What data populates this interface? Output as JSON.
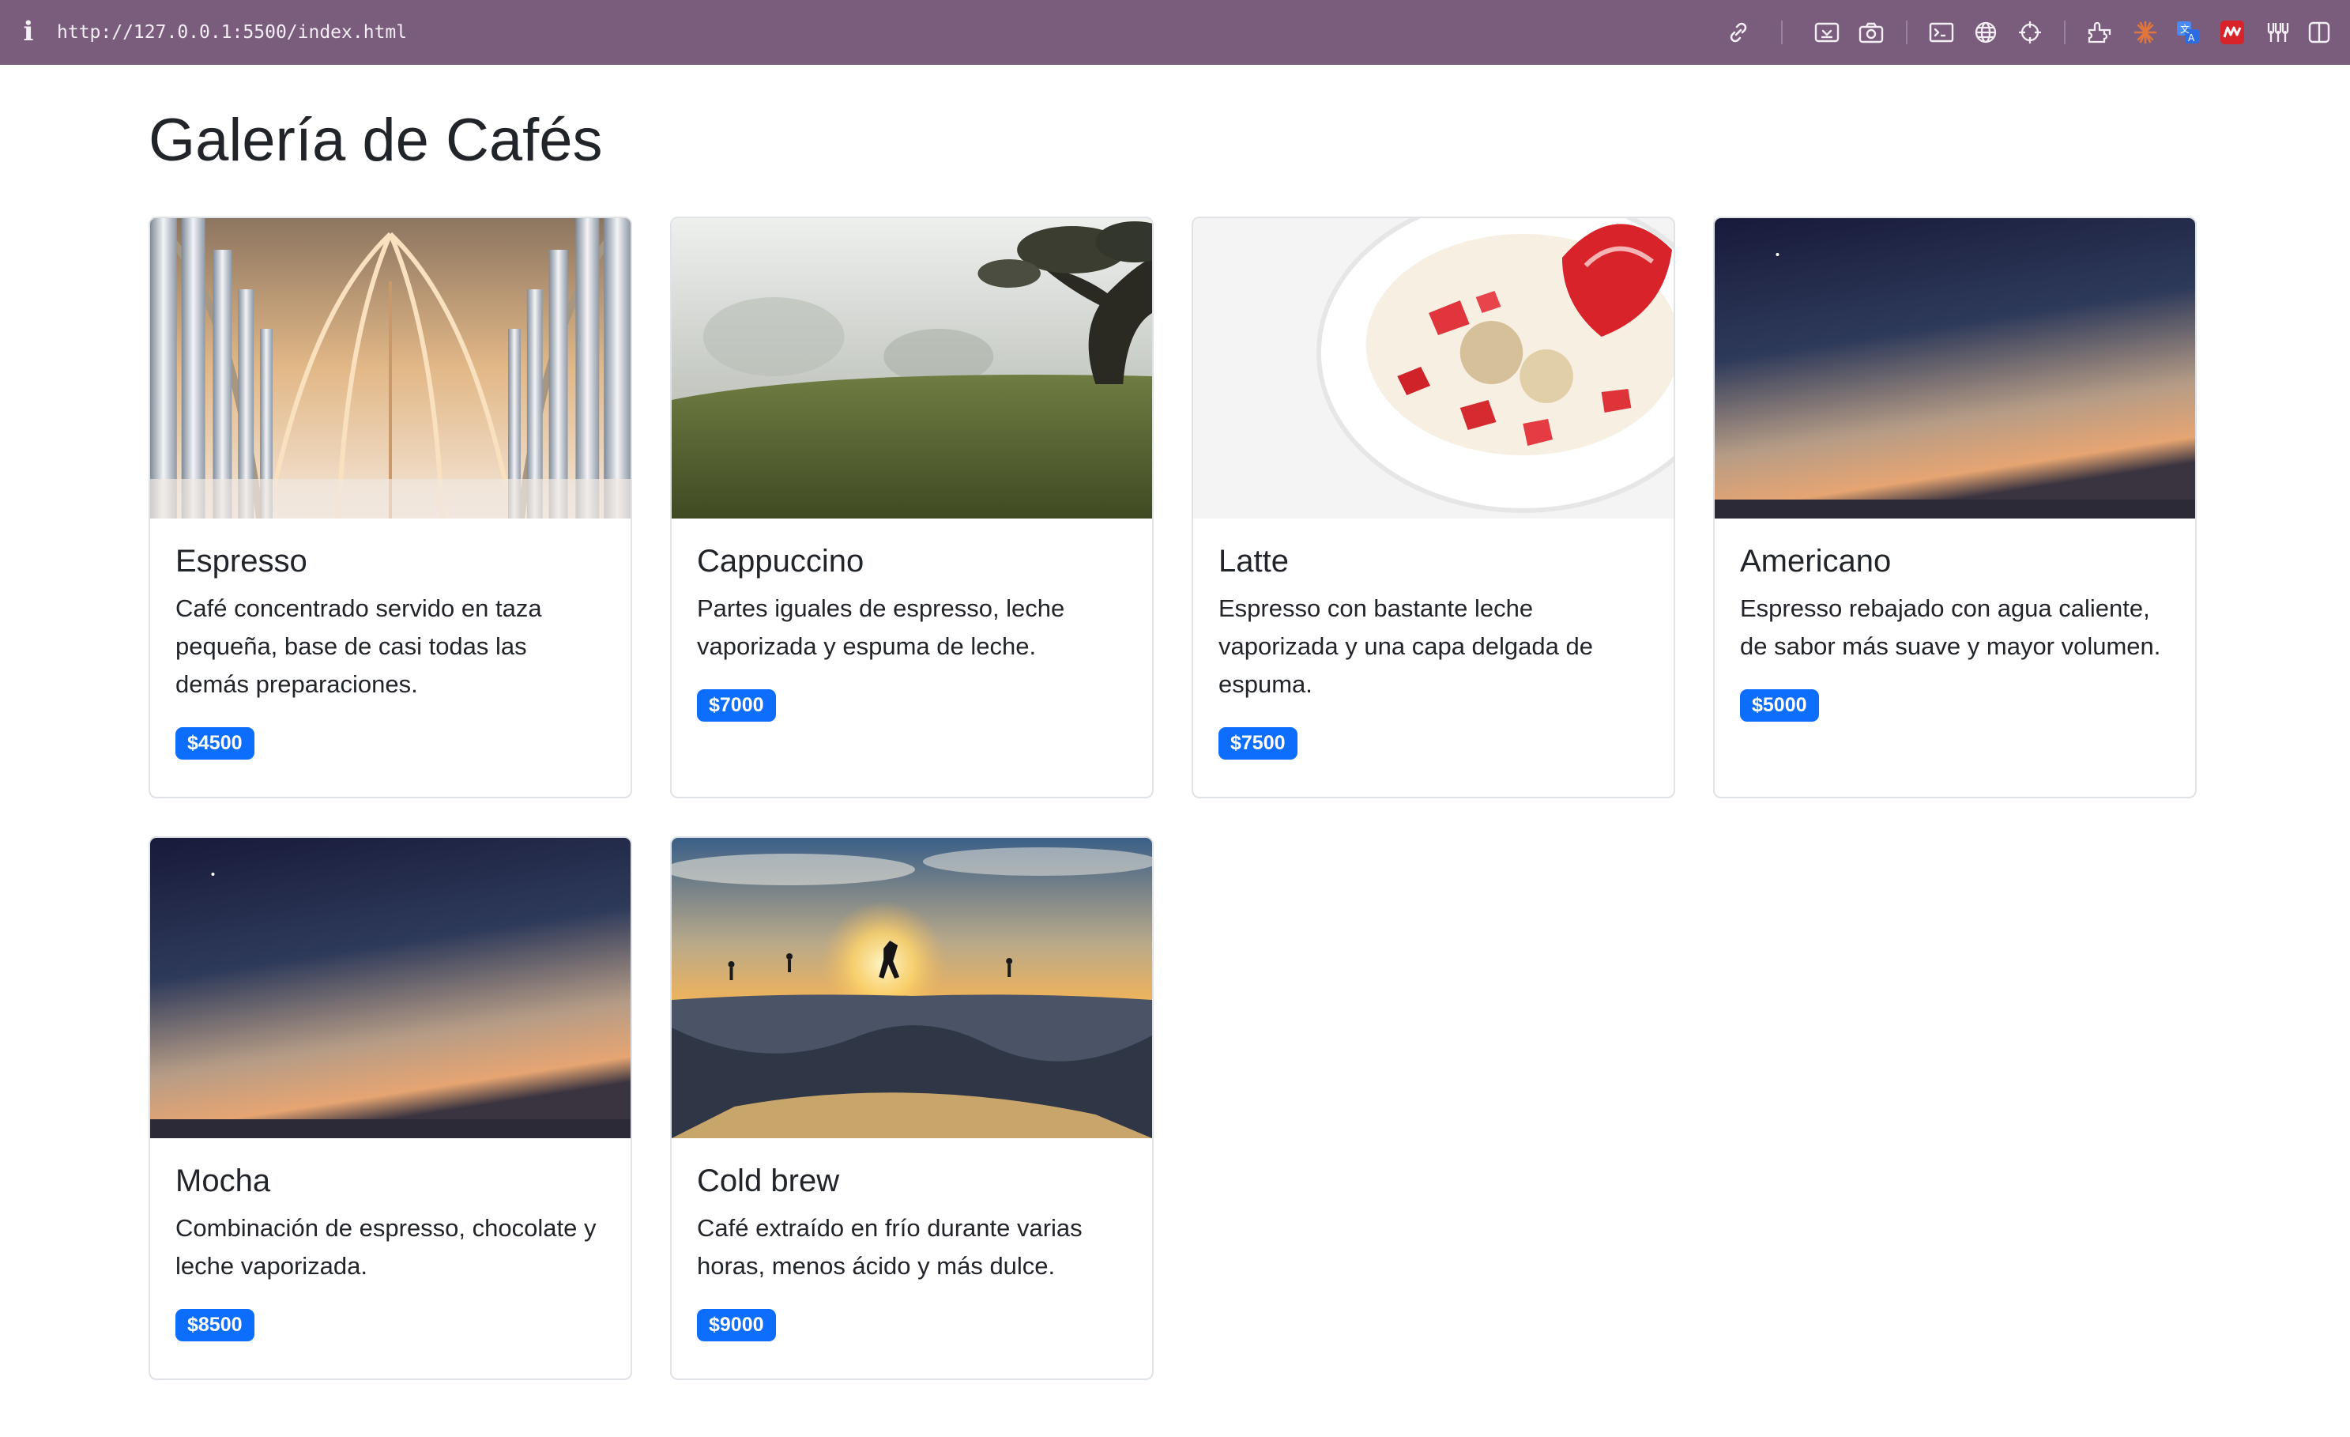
{
  "browser": {
    "url": "http://127.0.0.1:5500/index.html",
    "info_icon": "i",
    "toolbar_icons": [
      "link-icon",
      "screenshot-icon",
      "camera-icon",
      "terminal-icon",
      "globe-icon",
      "crosshair-icon",
      "extension-icon",
      "spark-icon",
      "translate-icon",
      "mendeley-icon",
      "tools-icon",
      "sidebar-icon"
    ]
  },
  "page": {
    "title": "Galería de Cafés"
  },
  "cards": [
    {
      "title": "Espresso",
      "text": "Café concentrado servido en taza pequeña, base de casi todas las demás preparaciones.",
      "price": "$4500",
      "image": "cathedral-arches"
    },
    {
      "title": "Cappuccino",
      "text": "Partes iguales de espresso, leche vaporizada y espuma de leche.",
      "price": "$7000",
      "image": "foggy-field-tree"
    },
    {
      "title": "Latte",
      "text": "Espresso con bastante leche vaporizada y una capa delgada de espuma.",
      "price": "$7500",
      "image": "yogurt-strawberries"
    },
    {
      "title": "Americano",
      "text": "Espresso rebajado con agua caliente, de sabor más suave y mayor volumen.",
      "price": "$5000",
      "image": "dusk-sky"
    },
    {
      "title": "Mocha",
      "text": "Combinación de espresso, chocolate y leche vaporizada.",
      "price": "$8500",
      "image": "dusk-sky"
    },
    {
      "title": "Cold brew",
      "text": "Café extraído en frío durante varias horas, menos ácido y más dulce.",
      "price": "$9000",
      "image": "skatepark-sunset"
    }
  ],
  "colors": {
    "toolbar_bg": "#7a5d7c",
    "badge_bg": "#0d6efd",
    "text": "#212529",
    "card_border": "#dfe2e6"
  }
}
